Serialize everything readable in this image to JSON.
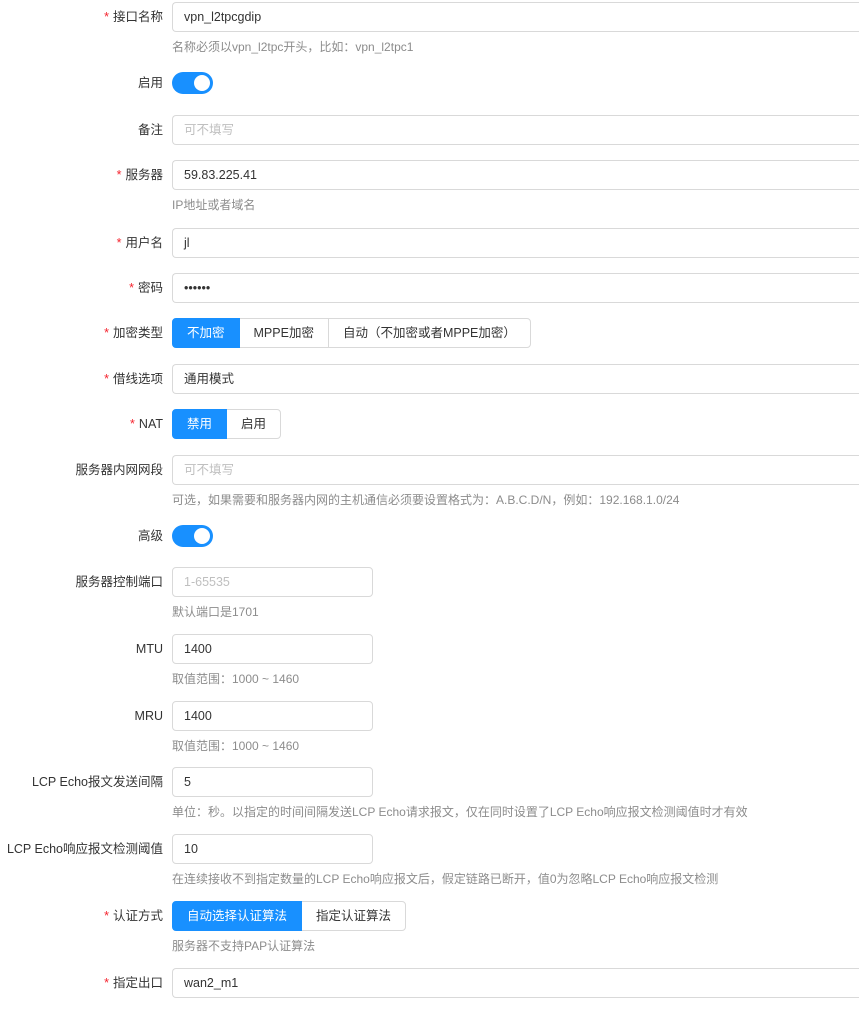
{
  "interface_name": {
    "label": "接口名称",
    "value": "vpn_l2tpcgdip",
    "help": "名称必须以vpn_l2tpc开头，比如：vpn_l2tpc1"
  },
  "enable": {
    "label": "启用",
    "on": true
  },
  "remark": {
    "label": "备注",
    "placeholder": "可不填写"
  },
  "server": {
    "label": "服务器",
    "value": "59.83.225.41",
    "help": "IP地址或者域名"
  },
  "username": {
    "label": "用户名",
    "value": "jl"
  },
  "password": {
    "label": "密码",
    "value": "••••••"
  },
  "encryption": {
    "label": "加密类型",
    "options": [
      "不加密",
      "MPPE加密",
      "自动（不加密或者MPPE加密）"
    ],
    "selected": "不加密"
  },
  "line_option": {
    "label": "借线选项",
    "value": "通用模式"
  },
  "nat": {
    "label": "NAT",
    "options": [
      "禁用",
      "启用"
    ],
    "selected": "禁用"
  },
  "server_subnet": {
    "label": "服务器内网网段",
    "placeholder": "可不填写",
    "help": "可选，如果需要和服务器内网的主机通信必须要设置格式为：A.B.C.D/N，例如：192.168.1.0/24"
  },
  "advanced": {
    "label": "高级",
    "on": true
  },
  "control_port": {
    "label": "服务器控制端口",
    "placeholder": "1-65535",
    "help": "默认端口是1701"
  },
  "mtu": {
    "label": "MTU",
    "value": "1400",
    "help": "取值范围：1000 ~ 1460"
  },
  "mru": {
    "label": "MRU",
    "value": "1400",
    "help": "取值范围：1000 ~ 1460"
  },
  "lcp_interval": {
    "label": "LCP Echo报文发送间隔",
    "value": "5",
    "help": "单位：秒。以指定的时间间隔发送LCP Echo请求报文，仅在同时设置了LCP Echo响应报文检测阈值时才有效"
  },
  "lcp_threshold": {
    "label": "LCP Echo响应报文检测阈值",
    "value": "10",
    "help": "在连续接收不到指定数量的LCP Echo响应报文后，假定链路已断开，值0为忽略LCP Echo响应报文检测"
  },
  "auth": {
    "label": "认证方式",
    "options": [
      "自动选择认证算法",
      "指定认证算法"
    ],
    "selected": "自动选择认证算法",
    "help": "服务器不支持PAP认证算法"
  },
  "egress": {
    "label": "指定出口",
    "value": "wan2_m1"
  },
  "colors": {
    "primary": "#1890ff",
    "required": "#f5222d",
    "border": "#d9d9d9",
    "help_text": "#8c8c8c"
  }
}
